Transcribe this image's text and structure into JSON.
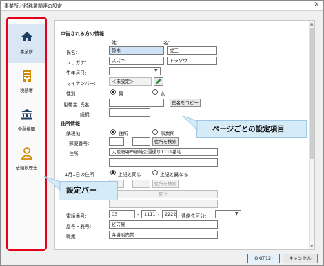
{
  "window": {
    "title": "事業所／税務署関連の設定",
    "close_glyph": "✕"
  },
  "sidebar": {
    "items": [
      {
        "label": "事業所",
        "icon": "home-icon"
      },
      {
        "label": "税務署",
        "icon": "building-icon"
      },
      {
        "label": "金融機関",
        "icon": "bank-icon"
      },
      {
        "label": "依頼税理士",
        "icon": "person-icon"
      }
    ]
  },
  "form": {
    "applicant_header": "申告される方の情報",
    "sei_label": "姓:",
    "mei_label": "名:",
    "name_label": "氏名:",
    "name_sei": "鈴木",
    "name_mei": "虎三",
    "furigana_label": "フリガナ:",
    "furigana_sei": "スズキ",
    "furigana_mei": "トラゾウ",
    "birthday_label": "生年月日:",
    "birthday_value": "",
    "mynumber_label": "マイナンバー:",
    "mynumber_value": "＜未設定＞",
    "gender_label": "性別:",
    "gender_male": "男",
    "gender_female": "女",
    "householder_label": "世帯主",
    "householder_name_label": "氏名:",
    "householder_name_value": "",
    "copy_name_button": "氏名をコピー",
    "relation_label": "続柄:",
    "relation_value": "",
    "address_header": "住所情報",
    "tax_place_label": "納税地",
    "tax_place_opt1": "住所",
    "tax_place_opt2": "事業所",
    "postal_label": "郵便番号:",
    "postal_1": "",
    "postal_2": "",
    "postal_sep": "-",
    "search_address_button": "住所を検索",
    "address_label": "住所:",
    "address_value": "大阪府堺市緑地公園通り1111番地",
    "address2_value": "",
    "jan1_label": "1月1日の住所",
    "jan1_opt1": "上記と同じ",
    "jan1_opt2": "上記と異なる",
    "jan1_postal_1": "",
    "jan1_postal_2": "",
    "jan1_search_button": "住所を検索",
    "same_button": "同上",
    "phone_label": "電話番号:",
    "phone_1": "03",
    "phone_2": "1111",
    "phone_3": "2222",
    "phone_sep": "-",
    "contact_label": "連絡先区分:",
    "contact_value": "",
    "shop_label": "屋号・雅号:",
    "shop_value": "ビズ屋",
    "job_label": "職業:",
    "job_value": "弁当販売業"
  },
  "annotations": {
    "page_items": "ページごとの設定項目",
    "settings_bar": "設定バー"
  },
  "footer": {
    "ok_button": "OK(F12)",
    "cancel_button": "キャンセル"
  },
  "colors": {
    "highlight_red": "#e2001a",
    "callout_bg": "#d6ebf8",
    "active_item_bg": "#dbe6f4",
    "icon_navy": "#1f3f63",
    "icon_gold": "#d28b00"
  }
}
